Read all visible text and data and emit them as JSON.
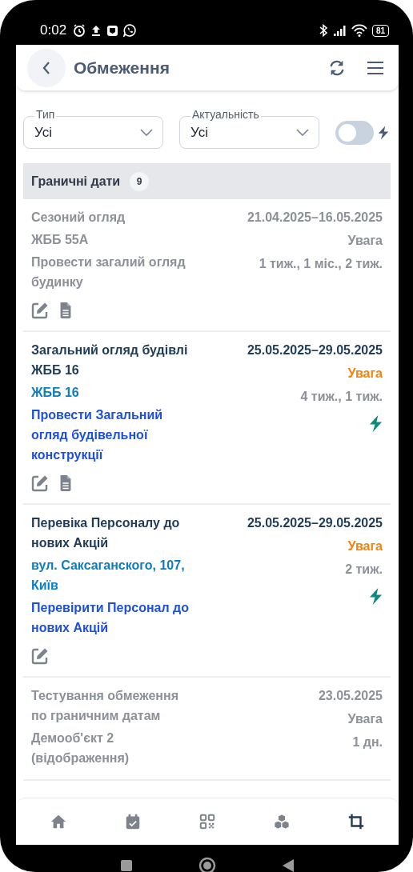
{
  "status_bar": {
    "time": "0:02",
    "battery": "81"
  },
  "header": {
    "title": "Обмеження"
  },
  "filters": {
    "selects": [
      {
        "label": "Тип",
        "value": "Усі"
      },
      {
        "label": "Актуальність",
        "value": "Усі"
      }
    ],
    "toggle": {
      "on": false
    }
  },
  "section": {
    "title": "Граничні дати",
    "count": "9"
  },
  "items": [
    {
      "inactive": true,
      "title": "Сезоний огляд",
      "object": "ЖББ 55А",
      "task": "Провести загалий огляд будинку",
      "period": "21.04.2025–16.05.2025",
      "status": "Увага",
      "intervals": "1 тиж., 1 міс., 2 тиж.",
      "flash": false,
      "actions": [
        {
          "kind": "edit"
        },
        {
          "kind": "document"
        }
      ]
    },
    {
      "inactive": false,
      "title": "Загальний огляд будівлі ЖББ 16",
      "object": "ЖББ 16",
      "task": "Провести Загальний огляд будівельної конструкції",
      "period": "25.05.2025–29.05.2025",
      "status": "Увага",
      "intervals": "4 тиж., 1 тиж.",
      "flash": true,
      "actions": [
        {
          "kind": "edit"
        },
        {
          "kind": "document"
        }
      ]
    },
    {
      "inactive": false,
      "title": "Перевіка Персоналу до нових Акцій",
      "object": "вул. Саксаганского, 107, Київ",
      "task": "Перевірити Персонал до нових Акцій",
      "period": "25.05.2025–29.05.2025",
      "status": "Увага",
      "intervals": "2 тиж.",
      "flash": true,
      "actions": [
        {
          "kind": "edit"
        }
      ]
    },
    {
      "inactive": true,
      "title": "Тестування обмеження по граничним датам",
      "object": "Демооб'єкт 2 (відображення)",
      "period": "23.05.2025",
      "status": "Увага",
      "intervals": "1 дн.",
      "flash": false
    }
  ],
  "nav": [
    {
      "kind": "home",
      "selected": false
    },
    {
      "kind": "calendar",
      "selected": false
    },
    {
      "kind": "qr",
      "selected": false
    },
    {
      "kind": "boxes",
      "selected": false
    },
    {
      "kind": "crop",
      "selected": true
    }
  ]
}
